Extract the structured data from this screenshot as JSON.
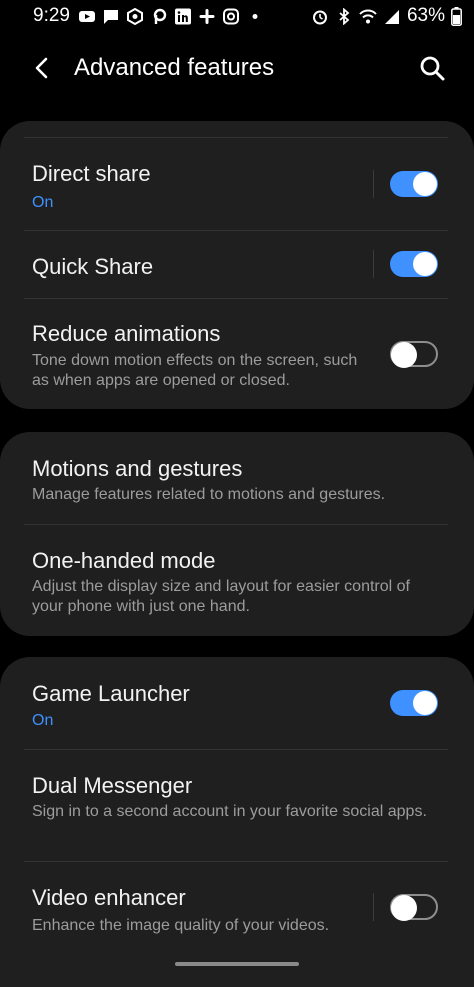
{
  "status_bar": {
    "time": "9:29",
    "battery": "63%",
    "left_icons": [
      "youtube-icon",
      "message-icon",
      "app-icon",
      "pinterest-icon",
      "linkedin-icon",
      "slack-icon",
      "instagram-icon",
      "dot-icon"
    ],
    "right_icons": [
      "alarm-icon",
      "bluetooth-icon",
      "wifi-icon",
      "signal-icon",
      "battery-icon"
    ]
  },
  "header": {
    "title": "Advanced features"
  },
  "sections": [
    {
      "items": [
        {
          "title": "Direct share",
          "subtitle": "On",
          "toggle": true
        },
        {
          "title": "Quick Share",
          "subtitle": "",
          "toggle": true
        },
        {
          "title": "Reduce animations",
          "subtitle": "Tone down motion effects on the screen, such as when apps are opened or closed.",
          "toggle": false
        }
      ]
    },
    {
      "items": [
        {
          "title": "Motions and gestures",
          "subtitle": "Manage features related to motions and gestures."
        },
        {
          "title": "One-handed mode",
          "subtitle": "Adjust the display size and layout for easier control of your phone with just one hand."
        }
      ]
    },
    {
      "items": [
        {
          "title": "Game Launcher",
          "subtitle": "On",
          "toggle": true
        },
        {
          "title": "Dual Messenger",
          "subtitle": "Sign in to a second account in your favorite social apps."
        },
        {
          "title": "Video enhancer",
          "subtitle": "Enhance the image quality of your videos.",
          "toggle": false
        }
      ]
    }
  ],
  "colors": {
    "accent": "#3e91ff",
    "card": "#1f1f1f",
    "background": "#000000"
  }
}
